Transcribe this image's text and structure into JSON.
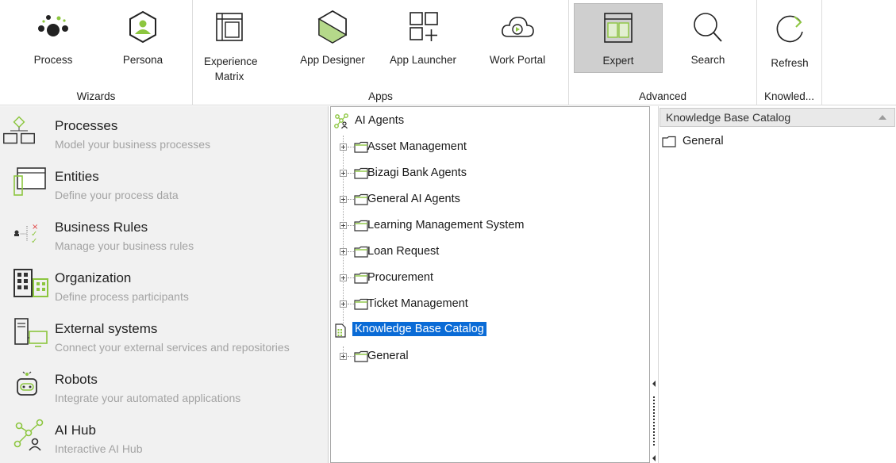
{
  "ribbon": {
    "groups": [
      {
        "label": "Wizards"
      },
      {
        "label": "Apps"
      },
      {
        "label": "Advanced"
      },
      {
        "label": "Knowled..."
      }
    ],
    "buttons": {
      "process": "Process",
      "persona": "Persona",
      "experience_matrix": "Experience Matrix",
      "app_designer": "App Designer",
      "app_launcher": "App Launcher",
      "work_portal": "Work Portal",
      "expert": "Expert",
      "search": "Search",
      "refresh": "Refresh"
    },
    "active_button": "Expert",
    "accent_green": "#8cc63f"
  },
  "left_nav": {
    "items": [
      {
        "title": "Processes",
        "subtitle": "Model your business processes",
        "icon": "processes-icon"
      },
      {
        "title": "Entities",
        "subtitle": "Define your process data",
        "icon": "entities-icon"
      },
      {
        "title": "Business Rules",
        "subtitle": "Manage your business rules",
        "icon": "business-rules-icon"
      },
      {
        "title": "Organization",
        "subtitle": "Define process participants",
        "icon": "organization-icon"
      },
      {
        "title": "External systems",
        "subtitle": "Connect your external services and repositories",
        "icon": "external-systems-icon"
      },
      {
        "title": "Robots",
        "subtitle": "Integrate your automated applications",
        "icon": "robots-icon"
      },
      {
        "title": "AI Hub",
        "subtitle": "Interactive AI Hub",
        "icon": "ai-hub-icon"
      }
    ]
  },
  "tree": {
    "root": "AI Agents",
    "children": [
      "Asset Management",
      "Bizagi Bank Agents",
      "General AI Agents",
      "Learning Management System",
      "Loan Request",
      "Procurement",
      "Ticket Management"
    ],
    "catalog_root": "Knowledge Base Catalog",
    "catalog_children": [
      "General"
    ],
    "selection_color": "#0a6bd6"
  },
  "catalog_panel": {
    "header": "Knowledge Base Catalog",
    "items": [
      "General"
    ]
  }
}
